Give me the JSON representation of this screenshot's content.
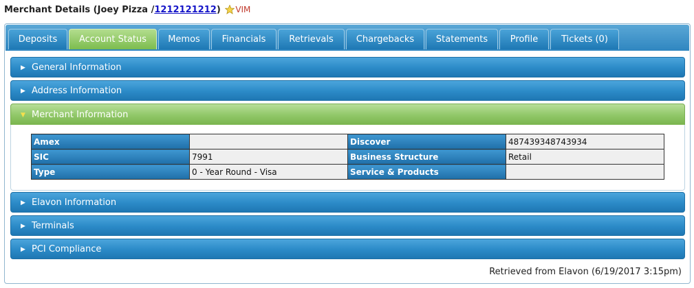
{
  "header": {
    "prefix": "Merchant Details (Joey Pizza /",
    "merchant_id": "1212121212",
    "suffix": ")",
    "badge": "VIM",
    "badge_icon": "star-icon"
  },
  "tabs": [
    {
      "label": "Deposits",
      "active": false
    },
    {
      "label": "Account Status",
      "active": true
    },
    {
      "label": "Memos",
      "active": false
    },
    {
      "label": "Financials",
      "active": false
    },
    {
      "label": "Retrievals",
      "active": false
    },
    {
      "label": "Chargebacks",
      "active": false
    },
    {
      "label": "Statements",
      "active": false
    },
    {
      "label": "Profile",
      "active": false
    },
    {
      "label": "Tickets (0)",
      "active": false
    }
  ],
  "sections": [
    {
      "label": "General Information",
      "open": false
    },
    {
      "label": "Address Information",
      "open": false
    },
    {
      "label": "Merchant Information",
      "open": true
    },
    {
      "label": "Elavon Information",
      "open": false
    },
    {
      "label": "Terminals",
      "open": false
    },
    {
      "label": "PCI Compliance",
      "open": false
    }
  ],
  "merchant_info": {
    "rows": [
      {
        "label1": "Amex",
        "value1": "",
        "label2": "Discover",
        "value2": "487439348743934"
      },
      {
        "label1": "SIC",
        "value1": "7991",
        "label2": "Business Structure",
        "value2": "Retail"
      },
      {
        "label1": "Type",
        "value1": "0 - Year Round - Visa",
        "label2": "Service & Products",
        "value2": ""
      }
    ]
  },
  "footer": {
    "retrieved": "Retrieved from Elavon (6/19/2017 3:15pm)"
  },
  "colors": {
    "tab_blue": "#2f86c0",
    "tab_green": "#7cbc4e",
    "link": "#1515c8",
    "badge": "#c0392b"
  }
}
